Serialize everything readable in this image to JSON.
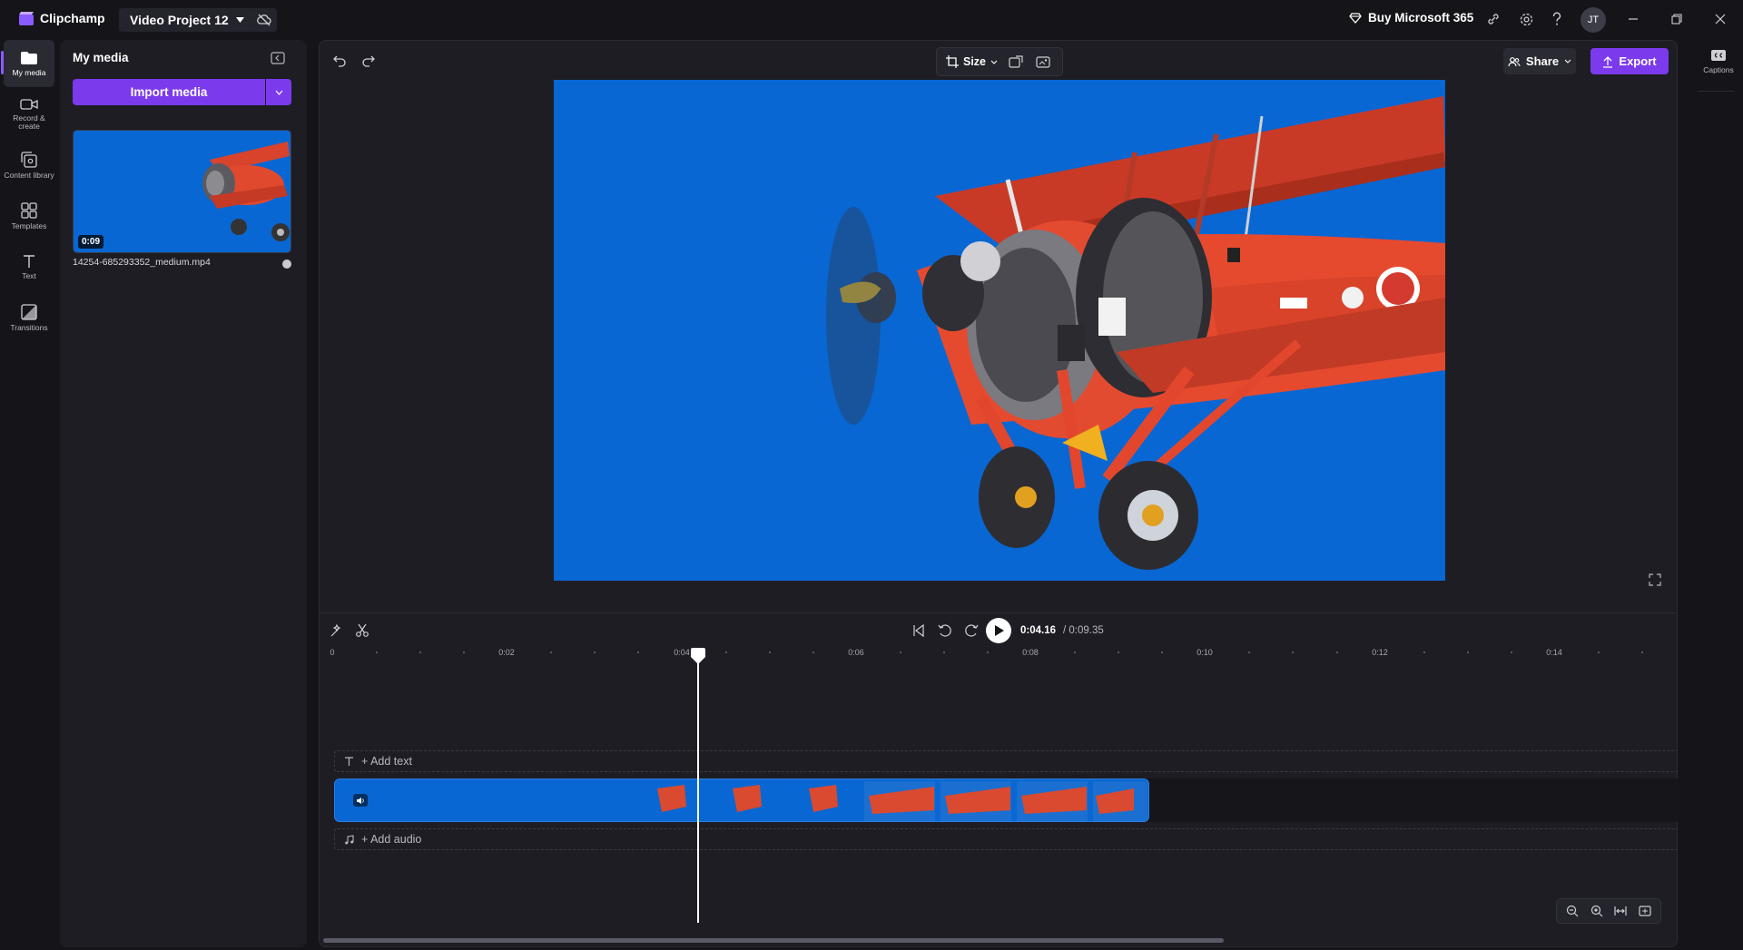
{
  "app": {
    "name": "Clipchamp",
    "project_title": "Video Project 12"
  },
  "titlebar": {
    "buy_label": "Buy Microsoft 365",
    "avatar_initials": "JT"
  },
  "rail": {
    "items": [
      {
        "label": "My media",
        "icon": "folder-icon",
        "active": true
      },
      {
        "label": "Record & create",
        "icon": "camera-icon"
      },
      {
        "label": "Content library",
        "icon": "library-icon"
      },
      {
        "label": "Templates",
        "icon": "templates-icon"
      },
      {
        "label": "Text",
        "icon": "text-icon"
      },
      {
        "label": "Transitions",
        "icon": "transitions-icon"
      }
    ]
  },
  "media": {
    "title": "My media",
    "import_label": "Import media",
    "items": [
      {
        "duration": "0:09",
        "filename": "14254-685293352_medium.mp4"
      }
    ]
  },
  "toolbar": {
    "size_label": "Size",
    "share_label": "Share",
    "export_label": "Export"
  },
  "playback": {
    "current_time": "0:04.16",
    "total_time": "/ 0:09.35"
  },
  "ruler": {
    "labels": [
      "0",
      "0:02",
      "0:04",
      "0:06",
      "0:08",
      "0:10",
      "0:12",
      "0:14"
    ]
  },
  "tracks": {
    "text_placeholder": "+ Add text",
    "audio_placeholder": "+ Add audio"
  },
  "right_rail": {
    "captions_label": "Captions"
  },
  "colors": {
    "accent": "#7c3aed",
    "clip_blue": "#0867d3",
    "panel_bg": "#1d1d23",
    "app_bg": "#151519"
  }
}
